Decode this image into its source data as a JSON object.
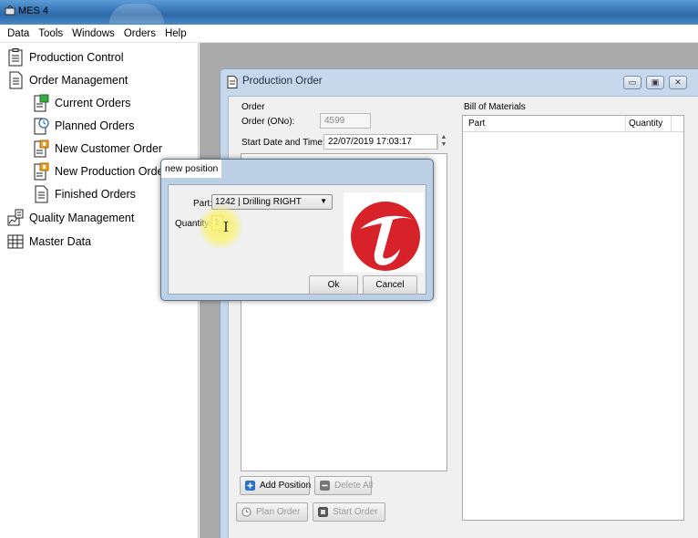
{
  "app": {
    "title": "MES 4"
  },
  "menu": [
    "Data",
    "Tools",
    "Windows",
    "Orders",
    "Help"
  ],
  "tree": {
    "items": [
      {
        "label": "Production Control",
        "icon": "clipboard-icon"
      },
      {
        "label": "Order Management",
        "icon": "document-icon"
      },
      {
        "label": "Current Orders",
        "icon": "current-orders-icon"
      },
      {
        "label": "Planned Orders",
        "icon": "planned-orders-icon"
      },
      {
        "label": "New Customer Order",
        "icon": "new-customer-order-icon"
      },
      {
        "label": "New Production Order",
        "icon": "new-production-order-icon"
      },
      {
        "label": "Finished Orders",
        "icon": "finished-orders-icon"
      },
      {
        "label": "Quality Management",
        "icon": "quality-icon"
      },
      {
        "label": "Master Data",
        "icon": "grid-icon"
      }
    ]
  },
  "production_order": {
    "title": "Production Order",
    "order_group": "Order",
    "order_no_label": "Order (ONo):",
    "order_no_value": "4599",
    "start_label": "Start Date and Time:",
    "start_value": "22/07/2019 17:03:17",
    "bom_group": "Bill of Materials",
    "bom_columns": [
      "Part",
      "Quantity"
    ],
    "add_position": "Add Position",
    "delete_all": "Delete All",
    "plan_order": "Plan Order",
    "start_order": "Start Order"
  },
  "dialog": {
    "title": "new position",
    "part_label": "Part:",
    "part_value": "1242 | Drilling RIGHT",
    "quantity_label": "Quantity:",
    "quantity_value": "1",
    "ok": "Ok",
    "cancel": "Cancel"
  },
  "colors": {
    "titlebar": "#3a78b8",
    "accent_red": "#d8222a",
    "window_frame": "#c6d9ec"
  }
}
